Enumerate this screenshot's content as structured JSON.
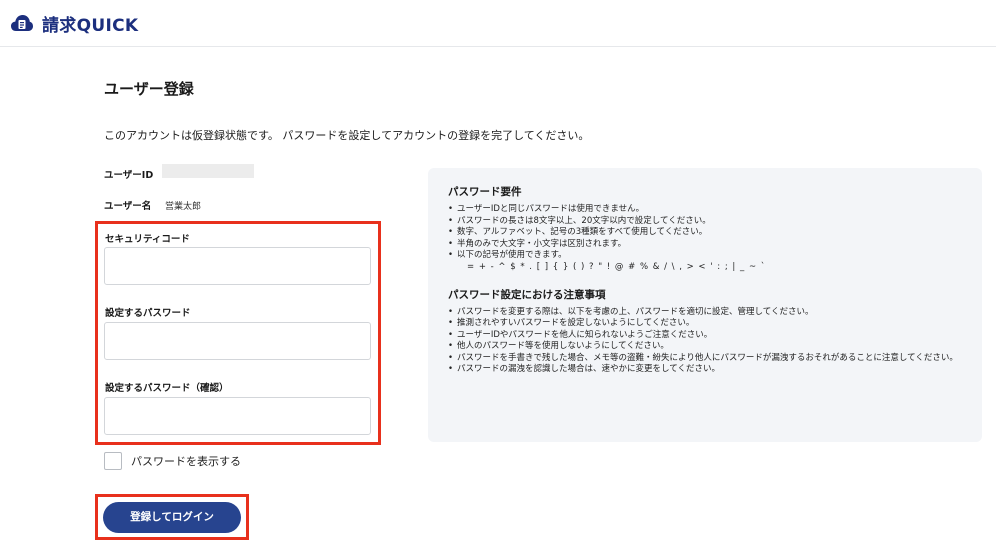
{
  "header": {
    "app_name": "請求QUICK",
    "logo_icon": "cloud-document-icon",
    "brand_color": "#1c2f7e"
  },
  "page": {
    "title": "ユーザー登録",
    "notice": "このアカウントは仮登録状態です。 パスワードを設定してアカウントの登録を完了してください。"
  },
  "user_info": {
    "userid_label": "ユーザーID",
    "userid_value": "",
    "username_label": "ユーザー名",
    "username_value": "営業太郎"
  },
  "form": {
    "security_code_label": "セキュリティコード",
    "security_code_value": "",
    "password_label": "設定するパスワード",
    "password_value": "",
    "password_confirm_label": "設定するパスワード（確認）",
    "password_confirm_value": "",
    "show_password_label": "パスワードを表示する",
    "show_password_checked": false,
    "submit_label": "登録してログイン",
    "submit_color": "#27448f",
    "highlight_color": "#e8301c"
  },
  "requirements": {
    "heading": "パスワード要件",
    "items": [
      "ユーザーIDと同じパスワードは使用できません。",
      "パスワードの長さは8文字以上、20文字以内で設定してください。",
      "数字、アルファベット、記号の3種類をすべて使用してください。",
      "半角のみで大文字・小文字は区別されます。",
      "以下の記号が使用できます。"
    ],
    "symbols": "= + - ^ $ * . [ ] { } ( ) ? \" ! @ # % & / \\ , > < ' : ; | _ ~ `"
  },
  "cautions": {
    "heading": "パスワード設定における注意事項",
    "items": [
      "パスワードを変更する際は、以下を考慮の上、パスワードを適切に設定、管理してください。",
      "推測されやすいパスワードを設定しないようにしてください。",
      "ユーザーIDやパスワードを他人に知られないようご注意ください。",
      "他人のパスワード等を使用しないようにしてください。",
      "パスワードを手書きで残した場合、メモ等の盗難・紛失により他人にパスワードが漏洩するおそれがあることに注意してください。",
      "パスワードの漏洩を認識した場合は、速やかに変更をしてください。"
    ]
  }
}
